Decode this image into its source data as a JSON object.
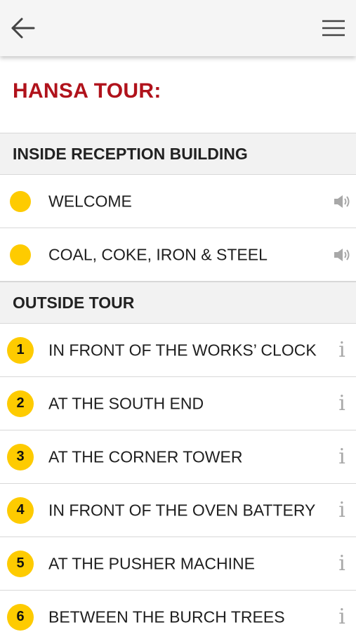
{
  "app": {
    "back_icon": "arrow-left-icon",
    "menu_icon": "hamburger-menu-icon"
  },
  "page": {
    "title": "HANSA TOUR:"
  },
  "colors": {
    "title": "#b0121b",
    "badge": "#fecb00",
    "header_bg": "#f2f2f2",
    "topbar_bg": "#f5f5f5",
    "action_icon": "#a8a8a8"
  },
  "sections": [
    {
      "title": "INSIDE RECEPTION BUILDING",
      "items": [
        {
          "badge": "",
          "label": "WELCOME",
          "action_icon": "speaker-icon"
        },
        {
          "badge": "",
          "label": "COAL, COKE, IRON & STEEL",
          "action_icon": "speaker-icon"
        }
      ]
    },
    {
      "title": "OUTSIDE TOUR",
      "items": [
        {
          "badge": "1",
          "label": "IN FRONT OF THE WORKS’ CLOCK",
          "action_icon": "info-icon",
          "action_glyph": "i"
        },
        {
          "badge": "2",
          "label": "AT THE SOUTH END",
          "action_icon": "info-icon",
          "action_glyph": "i"
        },
        {
          "badge": "3",
          "label": "AT THE CORNER TOWER",
          "action_icon": "info-icon",
          "action_glyph": "i"
        },
        {
          "badge": "4",
          "label": "IN FRONT OF THE OVEN BATTERY",
          "action_icon": "info-icon",
          "action_glyph": "i"
        },
        {
          "badge": "5",
          "label": "AT THE PUSHER MACHINE",
          "action_icon": "info-icon",
          "action_glyph": "i"
        },
        {
          "badge": "6",
          "label": "BETWEEN THE BURCH TREES",
          "action_icon": "info-icon",
          "action_glyph": "i"
        }
      ]
    }
  ]
}
